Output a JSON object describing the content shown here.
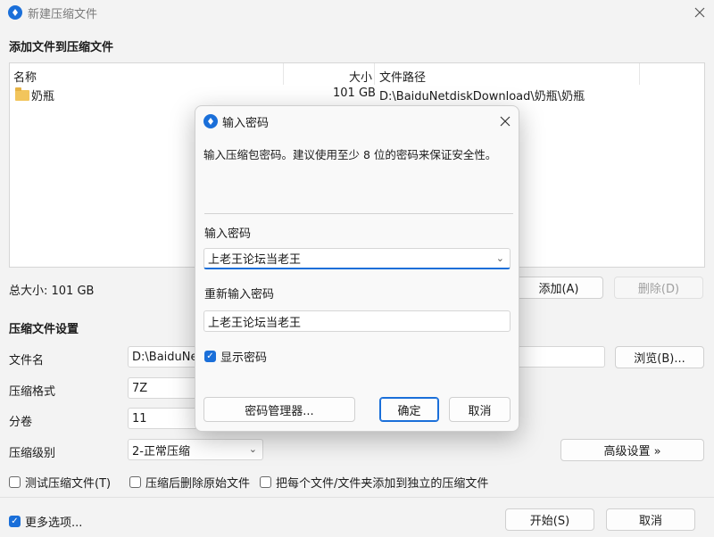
{
  "window": {
    "title": "新建压缩文件"
  },
  "files_section": {
    "heading": "添加文件到压缩文件",
    "columns": [
      "名称",
      "大小",
      "文件路径"
    ],
    "rows": [
      {
        "name": "奶瓶",
        "size": "101 GB",
        "path": "D:\\BaiduNetdiskDownload\\奶瓶\\奶瓶"
      }
    ],
    "total_size": "总大小: 101 GB",
    "add_button": "添加(A)",
    "delete_button": "删除(D)"
  },
  "settings": {
    "heading": "压缩文件设置",
    "filename_label": "文件名",
    "filename_value": "D:\\BaiduNet",
    "browse_button": "浏览(B)...",
    "format_label": "压缩格式",
    "format_value": "7Z",
    "volume_label": "分卷",
    "volume_value": "11",
    "level_label": "压缩级别",
    "level_value": "2-正常压缩",
    "advanced_button": "高级设置 »",
    "test_checkbox": "测试压缩文件(T)",
    "delete_after_checkbox": "压缩后删除原始文件",
    "separate_checkbox": "把每个文件/文件夹添加到独立的压缩文件"
  },
  "footer": {
    "more_options": "更多选项...",
    "start_button": "开始(S)",
    "cancel_button": "取消"
  },
  "dialog": {
    "title": "输入密码",
    "description": "输入压缩包密码。建议使用至少 8 位的密码来保证安全性。",
    "password_label": "输入密码",
    "password_value": "上老王论坛当老王",
    "reenter_label": "重新输入密码",
    "reenter_value": "上老王论坛当老王",
    "show_password": "显示密码",
    "manager_button": "密码管理器...",
    "ok_button": "确定",
    "cancel_button": "取消"
  },
  "colors": {
    "accent": "#1a6fd9"
  }
}
